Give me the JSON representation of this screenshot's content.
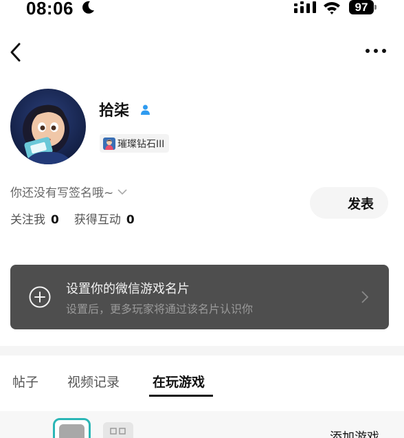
{
  "status_bar": {
    "time": "08:06",
    "battery": "97"
  },
  "nav": {
    "back_icon": "back-chevron-icon",
    "more_icon": "more-dots-icon"
  },
  "profile": {
    "username": "拾柒",
    "rank": "璀璨钻石III",
    "signature": "你还没有写签名哦~",
    "stats": [
      {
        "label": "关注我",
        "value": "0"
      },
      {
        "label": "获得互动",
        "value": "0"
      }
    ],
    "post_button": "发表"
  },
  "card": {
    "title": "设置你的微信游戏名片",
    "subtitle": "设置后，更多玩家将通过该名片认识你"
  },
  "tabs": [
    {
      "label": "帖子",
      "active": false
    },
    {
      "label": "视频记录",
      "active": false
    },
    {
      "label": "在玩游戏",
      "active": true
    }
  ],
  "bottom": {
    "add_game": "添加游戏"
  },
  "colors": {
    "card_bg": "#4e4e4e",
    "accent_teal": "#2bb6b6",
    "verify_blue": "#2f9bf0"
  }
}
